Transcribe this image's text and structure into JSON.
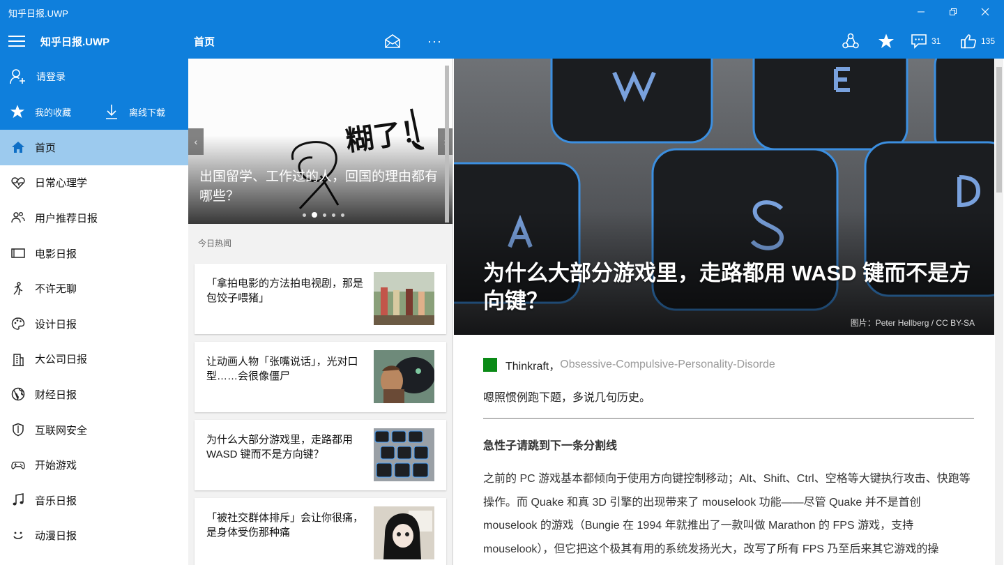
{
  "window": {
    "title": "知乎日报.UWP"
  },
  "header": {
    "app_title": "知乎日报.UWP",
    "page_title": "首页",
    "comments_count": "31",
    "likes_count": "135"
  },
  "sidebar": {
    "login_label": "请登录",
    "favorites_label": "我的收藏",
    "offline_label": "离线下载",
    "items": [
      {
        "label": "首页",
        "icon": "home-icon",
        "active": true
      },
      {
        "label": "日常心理学",
        "icon": "heart-icon"
      },
      {
        "label": "用户推荐日报",
        "icon": "users-icon"
      },
      {
        "label": "电影日报",
        "icon": "screen-icon"
      },
      {
        "label": "不许无聊",
        "icon": "figure-icon"
      },
      {
        "label": "设计日报",
        "icon": "palette-icon"
      },
      {
        "label": "大公司日报",
        "icon": "building-icon"
      },
      {
        "label": "财经日报",
        "icon": "globe-icon"
      },
      {
        "label": "互联网安全",
        "icon": "shield-icon"
      },
      {
        "label": "开始游戏",
        "icon": "gamepad-icon"
      },
      {
        "label": "音乐日报",
        "icon": "music-icon"
      },
      {
        "label": "动漫日报",
        "icon": "smiley-icon"
      }
    ]
  },
  "carousel": {
    "title": "出国留学、工作过的人，回国的理由都有哪些？",
    "overlay_scribble": "糊了！",
    "dots": 5,
    "active_dot": 1
  },
  "list": {
    "section_label": "今日热闻",
    "cards": [
      {
        "title": "「拿拍电影的方法拍电视剧，那是包饺子喂猪」"
      },
      {
        "title": "让动画人物「张嘴说话」，光对口型……会很像僵尸"
      },
      {
        "title": "为什么大部分游戏里，走路都用 WASD 键而不是方向键？"
      },
      {
        "title": "「被社交群体排斥」会让你很痛，是身体受伤那种痛"
      }
    ]
  },
  "article": {
    "title": "为什么大部分游戏里，走路都用 WASD 键而不是方向键？",
    "image_credit": "图片：Peter Hellberg / CC BY-SA",
    "author_name": "Thinkraft，",
    "author_bio": "Obsessive-Compulsive-Personality-Disorde",
    "intro": "嗯照惯例跑下题，多说几句历史。",
    "subheading": "急性子请跳到下一条分割线",
    "body": "之前的 PC 游戏基本都倾向于使用方向键控制移动；Alt、Shift、Ctrl、空格等大键执行攻击、快跑等操作。而 Quake 和真 3D 引擎的出现带来了 mouselook 功能——尽管 Quake 并不是首创 mouselook 的游戏（Bungie 在 1994 年就推出了一款叫做 Marathon 的 FPS 游戏，支持 mouselook），但它把这个极其有用的系统发扬光大，改写了所有 FPS 乃至后来其它游戏的操",
    "keycaps": [
      "W",
      "E",
      "A",
      "S",
      "D"
    ]
  },
  "colors": {
    "accent": "#0f7fdc",
    "active_nav": "#9ccaee",
    "author_badge": "#0a8a16"
  }
}
